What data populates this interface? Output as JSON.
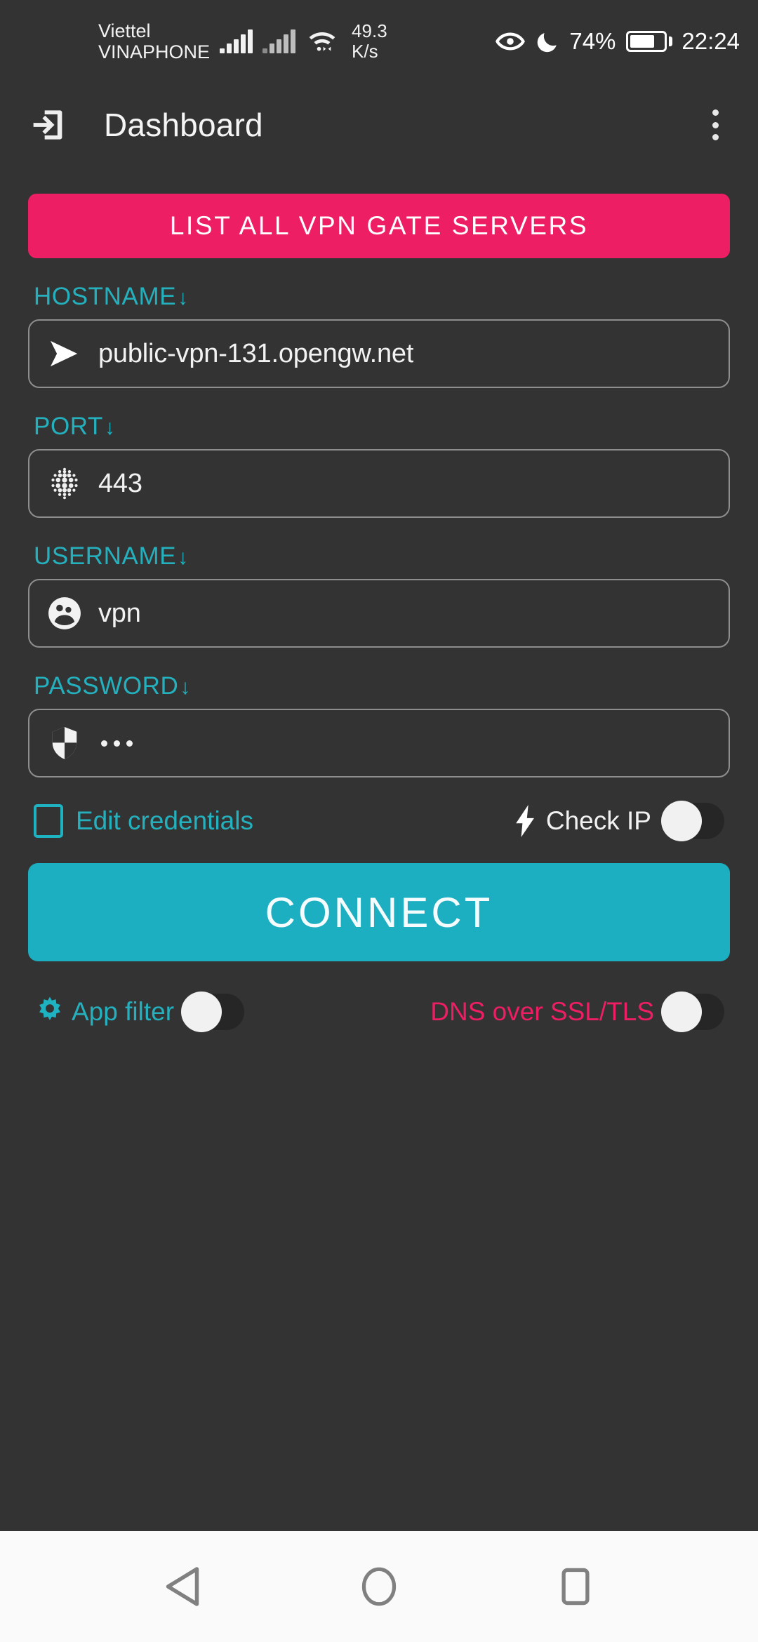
{
  "status_bar": {
    "carrier_line1": "Viettel",
    "carrier_line2": "VINAPHONE",
    "net_speed_value": "49.3",
    "net_speed_unit": "K/s",
    "eye_icon": "eye-icon",
    "moon_icon": "moon-icon",
    "battery_percent": "74%",
    "battery_level": 74,
    "time": "22:24"
  },
  "app_bar": {
    "nav_icon": "login-arrow-icon",
    "title": "Dashboard",
    "overflow_icon": "overflow-menu-icon"
  },
  "main": {
    "list_servers_button": "LIST ALL VPN GATE SERVERS",
    "fields": [
      {
        "label": "HOSTNAME",
        "arrow": "↓",
        "icon": "send-icon",
        "value": "public-vpn-131.opengw.net"
      },
      {
        "label": "PORT",
        "arrow": "↓",
        "icon": "dot-grid-icon",
        "value": "443"
      },
      {
        "label": "USERNAME",
        "arrow": "↓",
        "icon": "group-icon",
        "value": "vpn"
      },
      {
        "label": "PASSWORD",
        "arrow": "↓",
        "icon": "shield-icon",
        "value": "•••",
        "masked": true
      }
    ],
    "edit_credentials": {
      "label": "Edit credentials",
      "checked": false
    },
    "check_ip": {
      "icon": "bolt-icon",
      "label": "Check IP",
      "enabled": false
    },
    "connect_button": "CONNECT",
    "app_filter": {
      "icon": "gear-icon",
      "label": "App filter",
      "enabled": false
    },
    "dns_over_ssl": {
      "label": "DNS over SSL/TLS",
      "enabled": false
    }
  },
  "nav_bar": {
    "back": "back-triangle-icon",
    "home": "home-circle-icon",
    "recents": "recents-square-icon"
  },
  "colors": {
    "background": "#333333",
    "accent_pink": "#ED1E63",
    "accent_cyan": "#1CAFC2",
    "label_cyan": "#25B0BE",
    "field_border": "#8E8E8E",
    "text_light": "#F2F2F2",
    "nav_bar_bg": "#FAFAFA"
  }
}
